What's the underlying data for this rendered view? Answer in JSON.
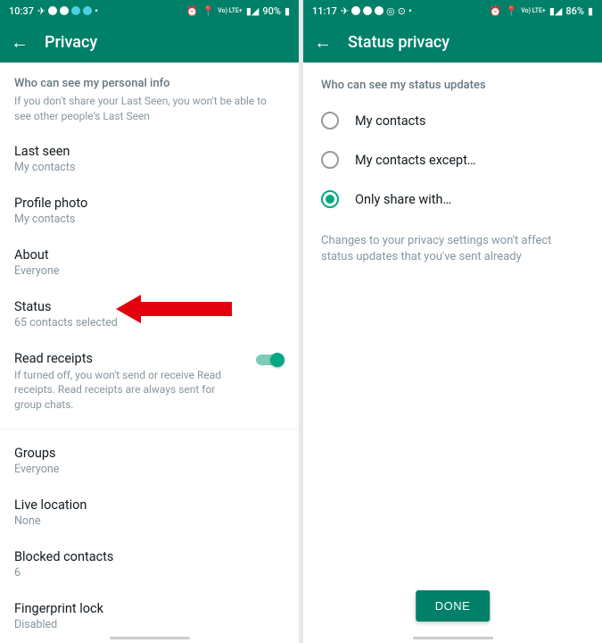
{
  "left": {
    "status_time": "10:37",
    "status_battery": "90%",
    "appbar_title": "Privacy",
    "header_title": "Who can see my personal info",
    "header_desc": "If you don't share your Last Seen, you won't be able to see other people's Last Seen",
    "last_seen_label": "Last seen",
    "last_seen_value": "My contacts",
    "profile_photo_label": "Profile photo",
    "profile_photo_value": "My contacts",
    "about_label": "About",
    "about_value": "Everyone",
    "status_label": "Status",
    "status_value": "65 contacts selected",
    "read_receipts_label": "Read receipts",
    "read_receipts_desc": "If turned off, you won't send or receive Read receipts. Read receipts are always sent for group chats.",
    "groups_label": "Groups",
    "groups_value": "Everyone",
    "live_location_label": "Live location",
    "live_location_value": "None",
    "blocked_label": "Blocked contacts",
    "blocked_value": "6",
    "fingerprint_label": "Fingerprint lock",
    "fingerprint_value": "Disabled"
  },
  "right": {
    "status_time": "11:17",
    "status_battery": "86%",
    "appbar_title": "Status privacy",
    "header_title": "Who can see my status updates",
    "opt1": "My contacts",
    "opt2": "My contacts except…",
    "opt3": "Only share with…",
    "note": "Changes to your privacy settings won't affect status updates that you've sent already",
    "done": "DONE"
  },
  "status_lte": "Vo) LTE+"
}
